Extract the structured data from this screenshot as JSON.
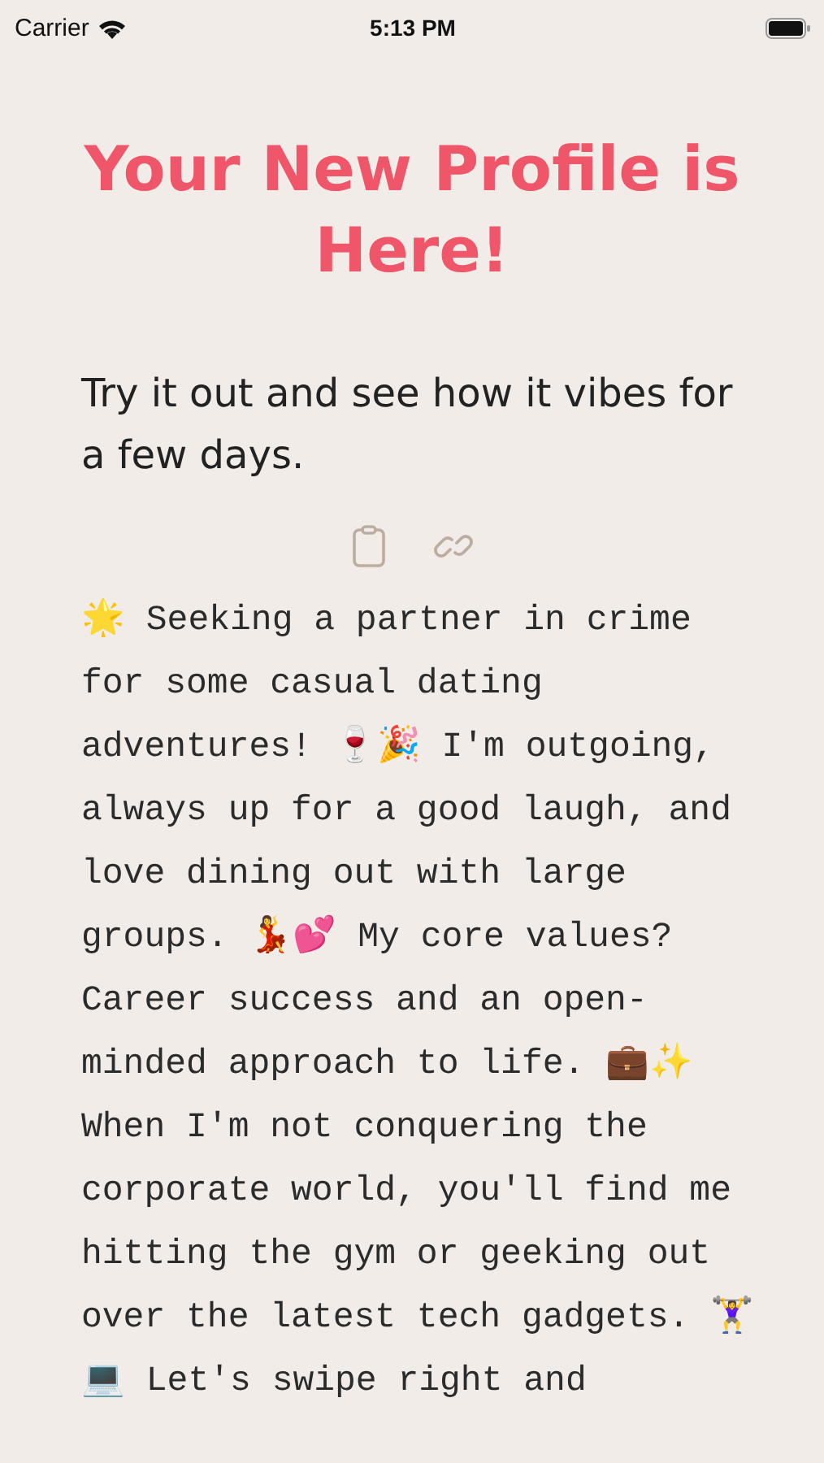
{
  "status_bar": {
    "carrier": "Carrier",
    "time": "5:13 PM"
  },
  "title": "Your New Profile is Here!",
  "subtitle": "Try it out and see how it vibes for a few days.",
  "actions": [
    {
      "kind": "copy"
    },
    {
      "kind": "link"
    }
  ],
  "bio": "🌟 Seeking a partner in crime for some casual dating adventures! 🍷🎉 I'm outgoing, always up for a good laugh, and love dining out with large groups. 💃💕 My core values? Career success and an open-minded approach to life. 💼✨ When I'm not conquering the corporate world, you'll find me hitting the gym or geeking out over the latest tech gadgets. 🏋️‍♀️💻 Let's swipe right and"
}
